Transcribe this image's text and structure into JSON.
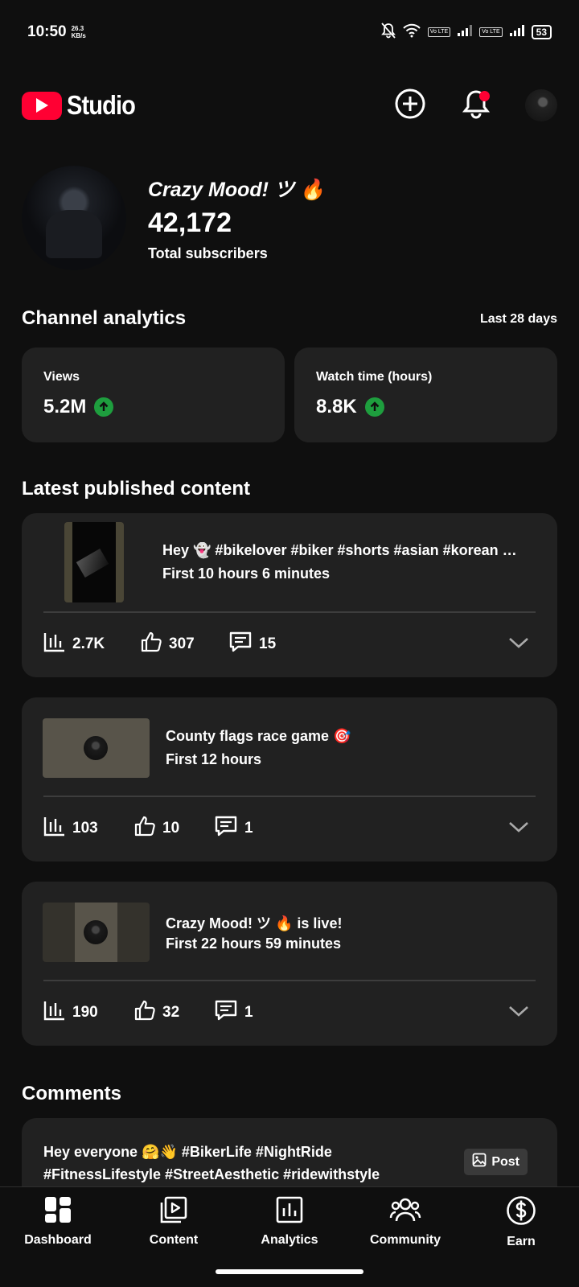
{
  "status_bar": {
    "time": "10:50",
    "speed_value": "26.3",
    "speed_unit": "KB/s",
    "volte1": "Vo LTE",
    "volte2": "Vo LTE",
    "battery": "53"
  },
  "header": {
    "app_name": "Studio",
    "brand_color": "#ff0033"
  },
  "channel": {
    "name": "Crazy Mood! ツ 🔥",
    "subscribers": "42,172",
    "subscribers_label": "Total subscribers"
  },
  "analytics": {
    "title": "Channel analytics",
    "period": "Last 28 days",
    "cards": [
      {
        "label": "Views",
        "value": "5.2M",
        "trend": "up"
      },
      {
        "label": "Watch time (hours)",
        "value": "8.8K",
        "trend": "up"
      }
    ]
  },
  "latest": {
    "title": "Latest published content",
    "items": [
      {
        "title": "Hey 👻 #bikelover #biker #shorts #asian #korean …",
        "subtitle": "First 10 hours 6 minutes",
        "views": "2.7K",
        "likes": "307",
        "comments": "15"
      },
      {
        "title": "County flags race game 🎯",
        "subtitle": "First 12 hours",
        "views": "103",
        "likes": "10",
        "comments": "1"
      },
      {
        "title": "Crazy Mood! ツ 🔥 is live!",
        "subtitle": "First 22 hours 59 minutes",
        "views": "190",
        "likes": "32",
        "comments": "1"
      }
    ]
  },
  "comments": {
    "title": "Comments",
    "preview_line1": "Hey everyone 🤗👋 #BikerLife #NightRide",
    "preview_line2": "#FitnessLifestyle #StreetAesthetic #ridewithstyle",
    "badge": "Post"
  },
  "nav": {
    "items": [
      {
        "label": "Dashboard",
        "icon": "dashboard-icon"
      },
      {
        "label": "Content",
        "icon": "content-icon"
      },
      {
        "label": "Analytics",
        "icon": "analytics-icon"
      },
      {
        "label": "Community",
        "icon": "community-icon"
      },
      {
        "label": "Earn",
        "icon": "earn-icon"
      }
    ]
  }
}
